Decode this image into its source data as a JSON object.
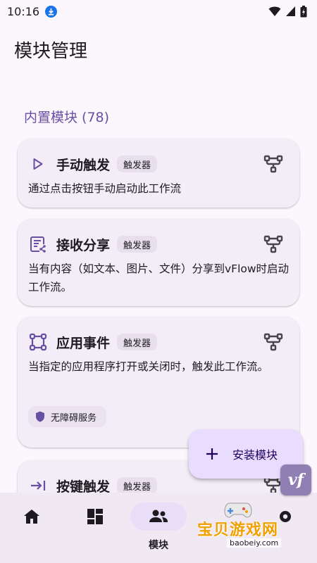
{
  "status_bar": {
    "time": "10:16"
  },
  "page_title": "模块管理",
  "section_title": "内置模块 (78)",
  "modules": [
    {
      "title": "手动触发",
      "tag": "触发器",
      "description": "通过点击按钮手动启动此工作流",
      "icon": "play-icon"
    },
    {
      "title": "接收分享",
      "tag": "触发器",
      "description": "当有内容（如文本、图片、文件）分享到vFlow时启动工作流。",
      "icon": "share-doc-icon"
    },
    {
      "title": "应用事件",
      "tag": "触发器",
      "description": "当指定的应用程序打开或关闭时，触发此工作流。",
      "icon": "app-frame-icon",
      "permission": "无障碍服务"
    },
    {
      "title": "按键触发",
      "tag": "触发器",
      "description": "",
      "icon": "key-trigger-icon"
    }
  ],
  "fab": {
    "label": "安装模块"
  },
  "bottom_nav": {
    "items": [
      {
        "label": "",
        "icon": "home-icon"
      },
      {
        "label": "",
        "icon": "dashboard-icon"
      },
      {
        "label": "模块",
        "icon": "modules-icon"
      },
      {
        "label": "",
        "icon": "settings-icon"
      }
    ]
  },
  "watermark": {
    "text": "宝贝游戏网",
    "url": "baobeiy.com",
    "logo": "vf"
  },
  "colors": {
    "primary": "#6750a4",
    "card_bg": "#f3edf7",
    "chip_bg": "#e7e0ec",
    "fab_bg": "#e9ddff",
    "nav_bg": "#f0e9f4"
  }
}
